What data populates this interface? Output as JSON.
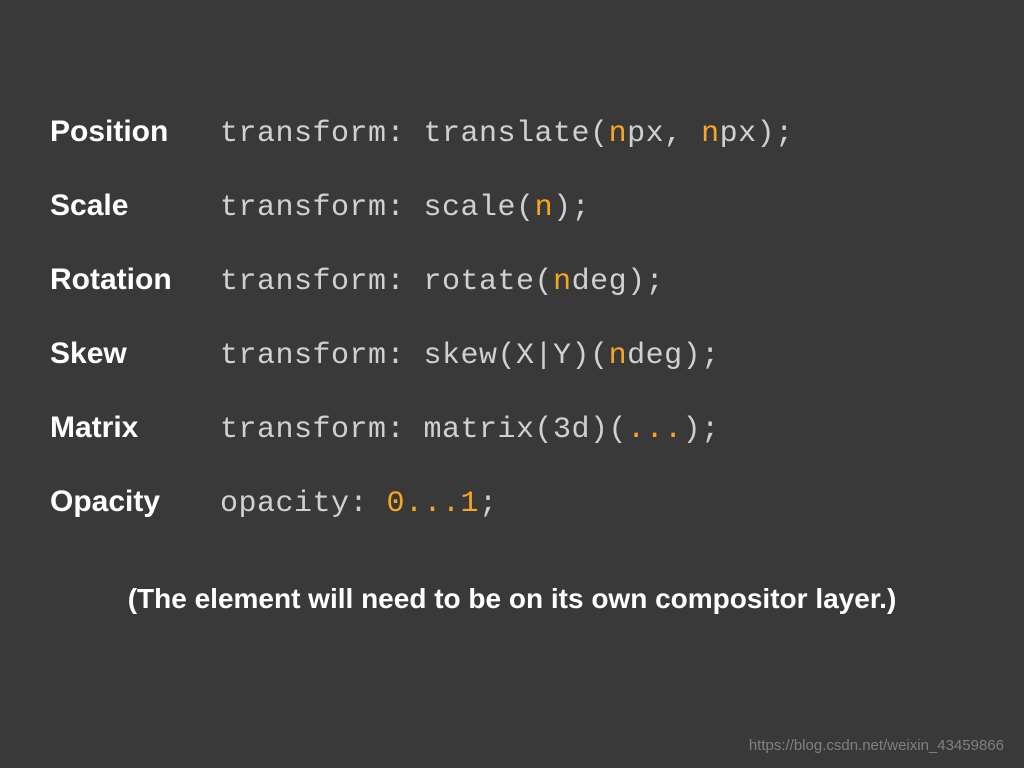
{
  "rows": [
    {
      "label": "Position",
      "code_pre": "transform: translate(",
      "code_hl1": "n",
      "code_mid1": "px, ",
      "code_hl2": "n",
      "code_post": "px);"
    },
    {
      "label": "Scale",
      "code_pre": "transform: scale(",
      "code_hl1": "n",
      "code_post": ");"
    },
    {
      "label": "Rotation",
      "code_pre": "transform: rotate(",
      "code_hl1": "n",
      "code_post": "deg);"
    },
    {
      "label": "Skew",
      "code_pre": "transform: skew(X|Y)(",
      "code_hl1": "n",
      "code_post": "deg);"
    },
    {
      "label": "Matrix",
      "code_pre": "transform: matrix(3d)(",
      "code_hl1": "...",
      "code_post": ");"
    },
    {
      "label": "Opacity",
      "code_pre": "opacity: ",
      "code_hl1": "0...1",
      "code_post": ";"
    }
  ],
  "note": "(The element will need to be on its own compositor layer.)",
  "watermark": "https://blog.csdn.net/weixin_43459866"
}
